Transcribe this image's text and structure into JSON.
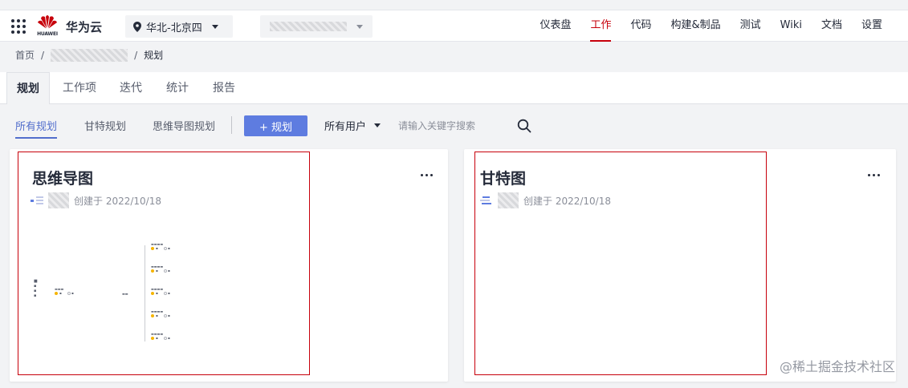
{
  "topbar": {
    "brand_logo_text": "HUAWEI",
    "brand_name": "华为云",
    "region": "华北-北京四",
    "nav": [
      "仪表盘",
      "工作",
      "代码",
      "构建&制品",
      "测试",
      "Wiki",
      "文档",
      "设置"
    ],
    "nav_active": "工作"
  },
  "breadcrumb": {
    "home": "首页",
    "sep": "/",
    "current": "规划"
  },
  "tabs": [
    "规划",
    "工作项",
    "迭代",
    "统计",
    "报告"
  ],
  "toolbar": {
    "subtabs": [
      "所有规划",
      "甘特规划",
      "思维导图规划"
    ],
    "add_button": "+ 规划",
    "user_filter": "所有用户",
    "search_placeholder": "请输入关键字搜索"
  },
  "cards": [
    {
      "title": "思维导图",
      "created": "创建于 2022/10/18",
      "type_icon": "mindmap-icon"
    },
    {
      "title": "甘特图",
      "created": "创建于 2022/10/18",
      "type_icon": "gantt-icon"
    }
  ],
  "watermark": "@稀土掘金技术社区",
  "colors": {
    "accent": "#5e7ce0",
    "active_nav": "#c7000b",
    "highlight_box": "#c7000b"
  }
}
